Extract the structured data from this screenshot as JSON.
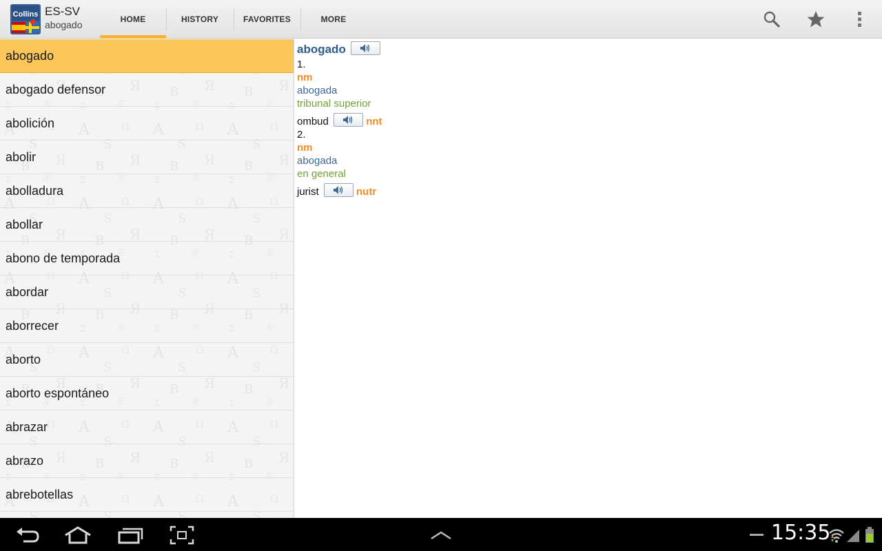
{
  "app": {
    "title": "ES-SV",
    "subtitle": "abogado",
    "logo_text": "Collins"
  },
  "tabs": [
    {
      "label": "HOME",
      "active": true
    },
    {
      "label": "HISTORY",
      "active": false
    },
    {
      "label": "FAVORITES",
      "active": false
    },
    {
      "label": "MORE",
      "active": false
    }
  ],
  "actions": [
    "search-icon",
    "star-icon",
    "overflow-menu-icon"
  ],
  "wordlist": {
    "selected_index": 0,
    "items": [
      "abogado",
      "abogado defensor",
      "abolición",
      "abolir",
      "abolladura",
      "abollar",
      "abono de temporada",
      "abordar",
      "aborrecer",
      "aborto",
      "aborto espontáneo",
      "abrazar",
      "abrazo",
      "abrebotellas"
    ]
  },
  "entry": {
    "headword": "abogado",
    "senses": [
      {
        "number": "1.",
        "pos": "nm",
        "form": "abogada",
        "context": "tribunal superior",
        "translation": "ombud",
        "gender": "nnt"
      },
      {
        "number": "2.",
        "pos": "nm",
        "form": "abogada",
        "context": "en general",
        "translation": "jurist",
        "gender": "nutr"
      }
    ]
  },
  "status": {
    "time": "15:35"
  },
  "colors": {
    "accent": "#f7b23b",
    "selected_row": "#fac559",
    "headword": "#2f5c8f",
    "pos": "#f08c22",
    "context": "#72a138"
  }
}
